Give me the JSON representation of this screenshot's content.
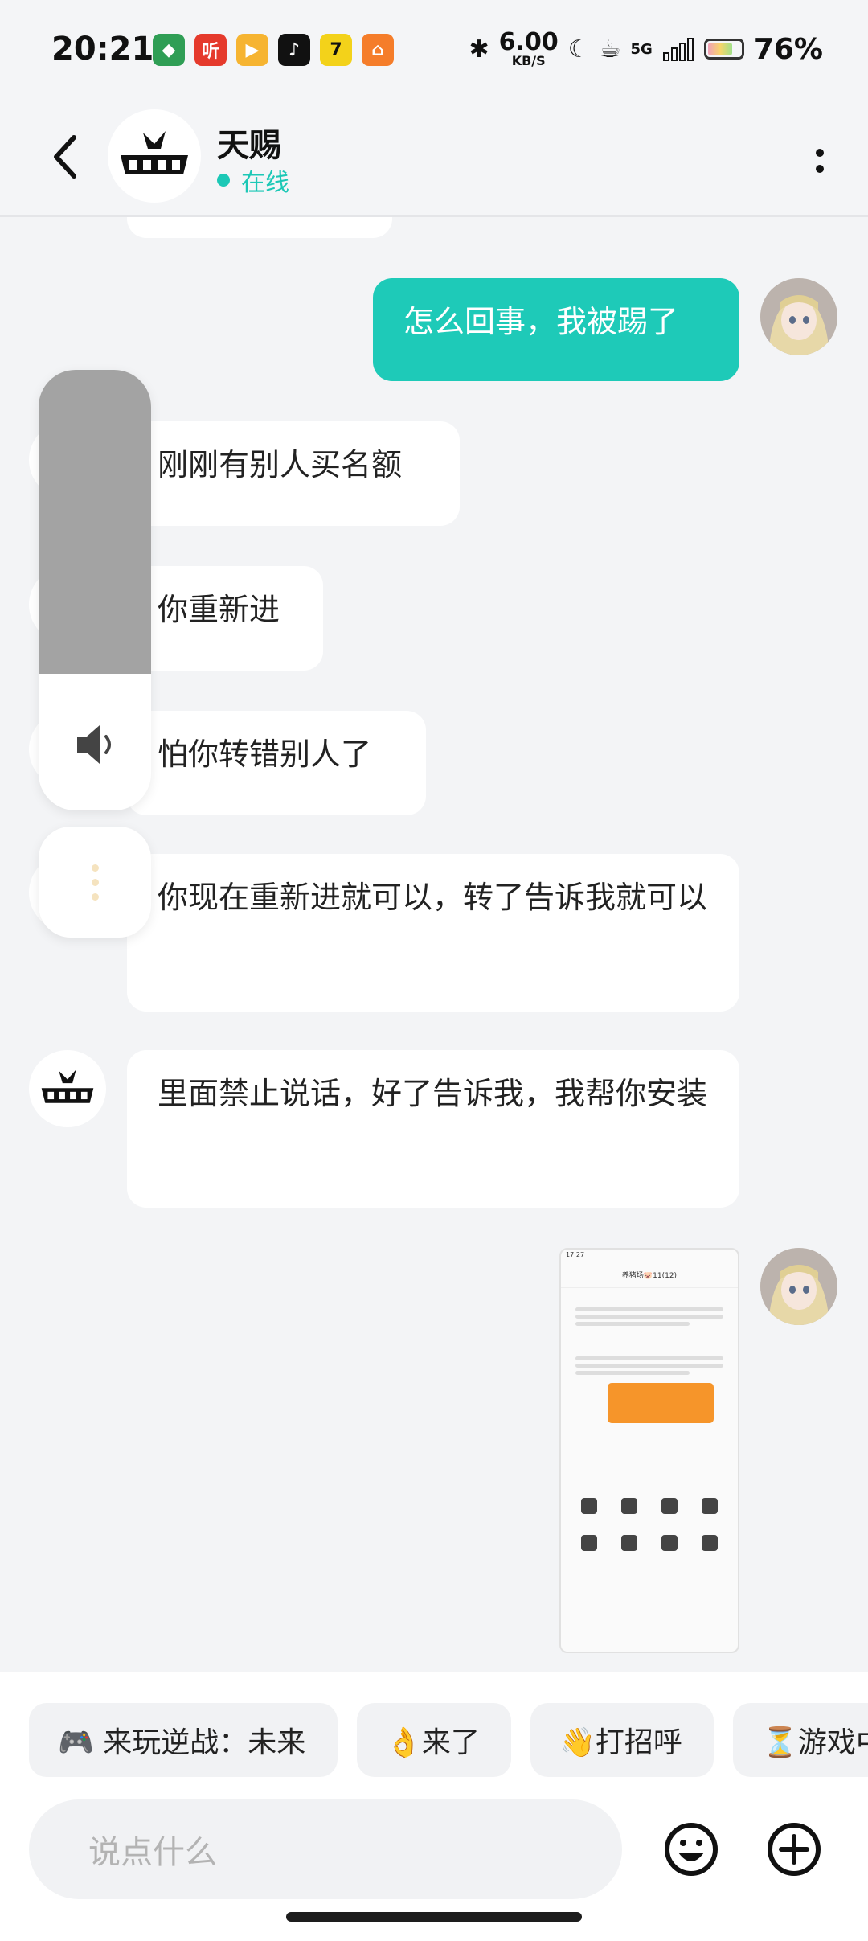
{
  "status_bar": {
    "time": "20:21",
    "net_speed": "6.00",
    "net_unit": "KB/S",
    "network": "5G",
    "battery": "76%",
    "battery_level": 0.76,
    "app_icons": [
      "tiktok-icon",
      "douyin-icon"
    ]
  },
  "header": {
    "contact_name": "天赐",
    "presence": "在线"
  },
  "messages": [
    {
      "from": "me",
      "text": "怎么回事，我被踢了"
    },
    {
      "from": "them",
      "text": "刚刚有别人买名额"
    },
    {
      "from": "them",
      "text": "你重新进"
    },
    {
      "from": "them",
      "text": "怕你转错别人了"
    },
    {
      "from": "them",
      "text": "你现在重新进就可以，转了告诉我就可以"
    },
    {
      "from": "them",
      "text": "里面禁止说话，好了告诉我，我帮你安装"
    },
    {
      "from": "me",
      "type": "image"
    }
  ],
  "screenshot_preview": {
    "time": "17:27",
    "title": "养猪场🐷11(12)"
  },
  "volume_overlay": {
    "level": 0.31
  },
  "quick_replies": [
    "🎮 来玩逆战：未来",
    "👌来了",
    "👋打招呼",
    "⏳游戏中"
  ],
  "composer": {
    "placeholder": "说点什么"
  },
  "colors": {
    "accent": "#1ecab8",
    "background": "#f3f4f6"
  }
}
